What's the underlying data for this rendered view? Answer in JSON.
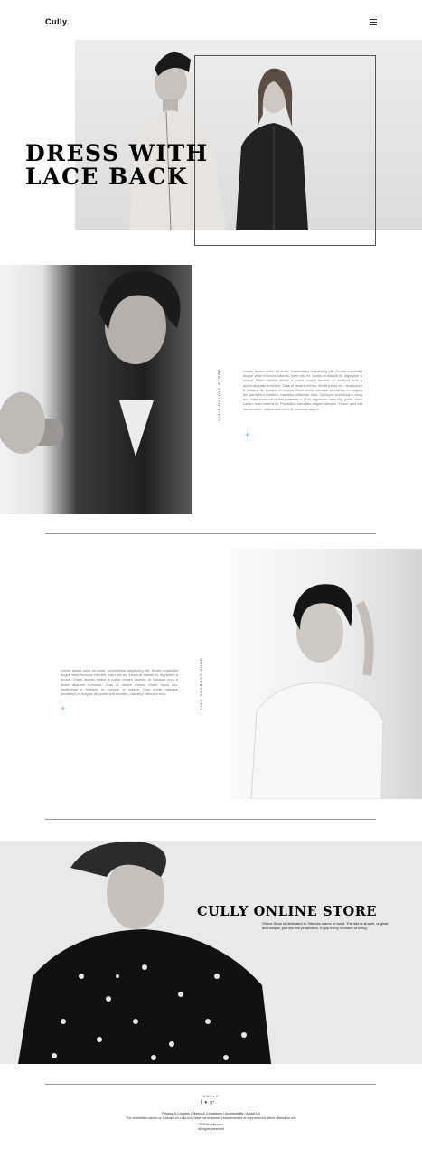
{
  "header": {
    "logo": "Cully",
    "logo_dot": ".",
    "menu_icon": "hamburger-menu-icon"
  },
  "hero": {
    "title_line1": "DRESS WITH",
    "title_line2": "LACE BACK"
  },
  "section1": {
    "vertical_label": "VISIT ONLINE STORE",
    "paragraph": "Lorem ipsum dolor sit amet, consectetur adipiscing elit. Donec imperdiet augue vitae rhoncus lobortis. Nam nisi ex, luctus at blandit et, dignissim a neque. Etiam lacinia metus a purus ornare laoreet. In volutpat eros a lorem aliquam tincidunt. Cras id ornare metus. Morbi turpis leo, vestibulum a tristique id, congue et massa. Cum sociis natoque penatibus et magnis dis parturient montes, nascetur ridiculus mus. Quisque scelerisque risus leo, vitae euismod lectus pharetra a. Duis dignissim sem nisl, justo, vitae rutrum odio viverra in. Phasellus convallis aliquet semper. Fusce quis est consectetur, malesuada sem id, placerat augue.",
    "plus_icon": "plus-icon",
    "accent": "#2bb8e8"
  },
  "section2": {
    "vertical_label": "FIND NEAREST SHOP",
    "paragraph": "Lorem ipsum dolor sit amet, consectetur adipiscing elit. Donec imperdiet augue vitae rhoncus lobortis. Nam nisi ex, luctus at blandit et, dignissim a neque. Etiam lacinia metus a purus ornare laoreet. In volutpat eros a lorem aliquam tincidunt. Cras id ornare metus. Morbi turpis leo, vestibulum a tristique id, congue et massa. Cum sociis natoque penatibus et magnis dis parturient montes, nascetur ridiculus mus.",
    "plus_icon": "plus-icon"
  },
  "section3": {
    "title": "CULLY ONLINE STORE",
    "text": "Online Store is dedicated to Siberian wares of word. The site is simple, original and unique, just like the production. Enjoy every moment of using."
  },
  "footer": {
    "brand": "CULLY",
    "social": [
      {
        "icon": "facebook-icon",
        "glyph": "f"
      },
      {
        "icon": "twitter-icon",
        "glyph": "♥"
      },
      {
        "icon": "google-plus-icon",
        "glyph": "g⁺"
      }
    ],
    "links": [
      "Privacy & Cookies",
      "Terms & Conditions",
      "Accessibility",
      "About Us"
    ],
    "note": "The celebrities named or featured on cully.com have not endorsed recommended or approved the items offered on site",
    "copyright": "©2016 cully.com",
    "rights": "All rights reserved"
  }
}
